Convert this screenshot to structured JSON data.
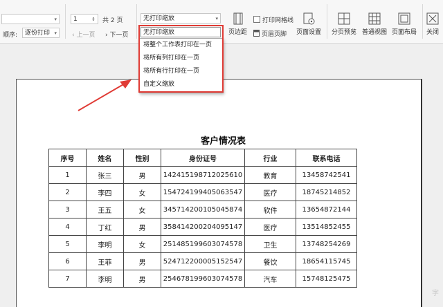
{
  "toolbar": {
    "order_label": "顺序:",
    "order_value": "逐份打印",
    "page_value": "1",
    "total_pages": "共 2 页",
    "prev_page": "上一页",
    "next_page": "下一页",
    "scale_value": "无打印缩放",
    "print_gridlines": "打印网格线",
    "header_footer": "页眉页脚",
    "margins": "页边距",
    "page_setup": "页面设置",
    "page_break_preview": "分页预览",
    "normal_view": "普通视图",
    "page_layout": "页面布局",
    "close": "关闭"
  },
  "scale_dropdown": {
    "selected": "无打印缩放",
    "options": [
      "将整个工作表打印在一页",
      "将所有列打印在一页",
      "将所有行打印在一页",
      "自定义缩放"
    ]
  },
  "annotation": {
    "color": "#e03b35"
  },
  "sheet": {
    "title": "客户情况表",
    "headers": [
      "序号",
      "姓名",
      "性别",
      "身份证号",
      "行业",
      "联系电话"
    ],
    "rows": [
      [
        "1",
        "张三",
        "男",
        "142415198712025610",
        "教育",
        "13458742541"
      ],
      [
        "2",
        "李四",
        "女",
        "154724199405063547",
        "医疗",
        "18745214852"
      ],
      [
        "3",
        "王五",
        "女",
        "345714200105045874",
        "软件",
        "13654872144"
      ],
      [
        "4",
        "丁红",
        "男",
        "358414200204095147",
        "医疗",
        "13514852455"
      ],
      [
        "5",
        "李明",
        "女",
        "251485199603074578",
        "卫生",
        "13748254269"
      ],
      [
        "6",
        "王菲",
        "男",
        "524712200005152547",
        "餐饮",
        "18654115745"
      ],
      [
        "7",
        "李明",
        "男",
        "254678199603074578",
        "汽车",
        "15748125475"
      ]
    ]
  },
  "watermark": "字"
}
